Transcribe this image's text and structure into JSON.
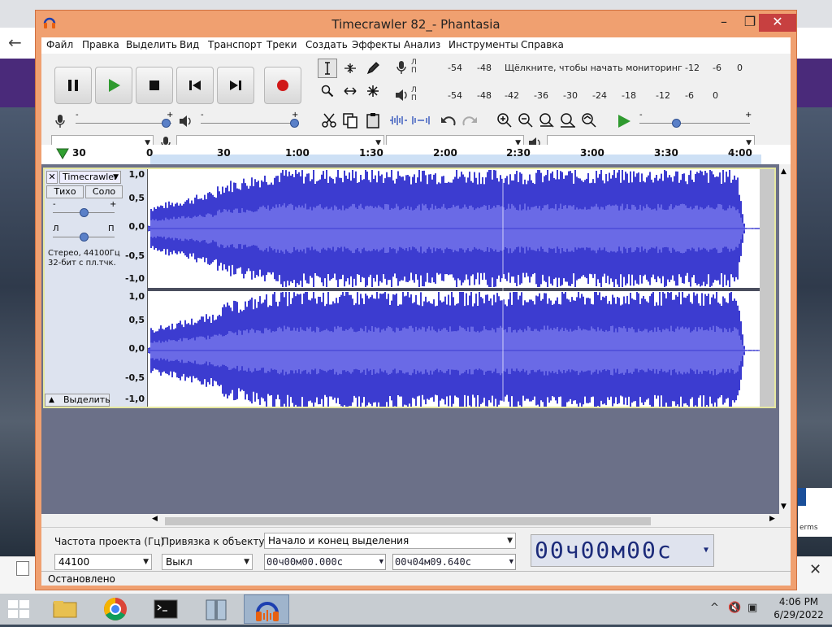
{
  "window": {
    "title": "Timecrawler 82_- Phantasia",
    "minimize": "–",
    "maximize": "❐",
    "close": "✕"
  },
  "menu": [
    "Файл",
    "Правка",
    "Выделить",
    "Вид",
    "Транспорт",
    "Треки",
    "Создать",
    "Эффекты",
    "Анализ",
    "Инструменты",
    "Справка"
  ],
  "transport": {
    "buttons": [
      "pause-icon",
      "play-icon",
      "stop-icon",
      "skip-start-icon",
      "skip-end-icon",
      "record-icon"
    ],
    "colors": {
      "play": "#2f9a2f",
      "record": "#d01818"
    }
  },
  "meters": {
    "record": {
      "l": "Л",
      "p": "П",
      "ticks": [
        "-54",
        "-48",
        "-12",
        "-6",
        "0"
      ],
      "hint": "Щёлкните, чтобы начать мониторинг"
    },
    "play": {
      "l": "Л",
      "p": "П",
      "ticks": [
        "-54",
        "-48",
        "-42",
        "-36",
        "-30",
        "-24",
        "-18",
        "-12",
        "-6",
        "0"
      ]
    }
  },
  "mixer": {
    "rec_minus": "-",
    "rec_plus": "+",
    "play_minus": "-",
    "play_plus": "+",
    "rec_level": 0.94,
    "play_level": 0.96,
    "play_speed_minus": "-",
    "play_speed_plus": "+",
    "play_speed": 0.33
  },
  "devices": {
    "host": "",
    "rec_device": "",
    "channels": "",
    "play_device": ""
  },
  "ruler": {
    "labels": [
      "30",
      "0",
      "30",
      "1:00",
      "1:30",
      "2:00",
      "2:30",
      "3:00",
      "3:30",
      "4:00"
    ]
  },
  "track": {
    "close": "✕",
    "name": "Timecrawler",
    "mute": "Тихо",
    "solo": "Соло",
    "gain_minus": "-",
    "gain_plus": "+",
    "pan_l": "Л",
    "pan_r": "П",
    "info_line1": "Стерео, 44100Гц",
    "info_line2": "32-бит с пл.тчк.",
    "select": "Выделить",
    "gain_value": 0.5,
    "pan_value": 0.5,
    "scale": [
      "1,0",
      "0,5",
      "0,0",
      "-0,5",
      "-1,0"
    ]
  },
  "bottom": {
    "rate_label": "Частота проекта (Гц)",
    "snap_label": "Привязка к объекту",
    "rate_value": "44100",
    "snap_value": "Выкл",
    "selection_mode": "Начало и конец выделения",
    "sel_start": "00ч00м00.000с",
    "sel_end": "00ч04м09.640с",
    "position": "00ч00м00с"
  },
  "status": "Остановлено",
  "taskbar": {
    "time": "4:06 PM",
    "date": "6/29/2022",
    "items": [
      "file-explorer-icon",
      "chrome-icon",
      "terminal-icon",
      "archive-icon",
      "audacity-icon"
    ]
  }
}
